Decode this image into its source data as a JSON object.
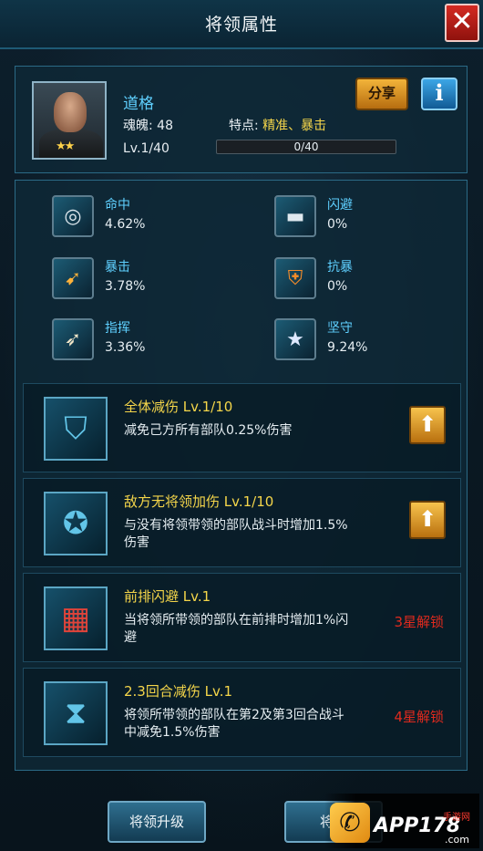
{
  "header": {
    "title": "将领属性",
    "close_symbol": "✕"
  },
  "hero": {
    "name": "道格",
    "soul_label": "魂魄: 48",
    "trait_label": "特点:",
    "trait_value": "精准、暴击",
    "level": "Lv.1/40",
    "exp_text": "0/40",
    "exp_fraction": 0,
    "stars": "★★",
    "share_label": "分享",
    "info_label": "i"
  },
  "stats": [
    {
      "name": "命中",
      "value": "4.62%",
      "icon": "target-icon"
    },
    {
      "name": "闪避",
      "value": "0%",
      "icon": "tank-icon"
    },
    {
      "name": "暴击",
      "value": "3.78%",
      "icon": "missile-icon"
    },
    {
      "name": "抗暴",
      "value": "0%",
      "icon": "shield-badge-icon"
    },
    {
      "name": "指挥",
      "value": "3.36%",
      "icon": "rocket-icon"
    },
    {
      "name": "坚守",
      "value": "9.24%",
      "icon": "star-shield-icon"
    }
  ],
  "skills": [
    {
      "name": "全体减伤 Lv.1/10",
      "desc": "减免己方所有部队0.25%伤害",
      "action": "upgrade",
      "icon": "shield-skill-icon"
    },
    {
      "name": "敌方无将领加伤 Lv.1/10",
      "desc": "与没有将领带领的部队战斗时增加1.5%伤害",
      "action": "upgrade",
      "icon": "medal-skill-icon"
    },
    {
      "name": "前排闪避 Lv.1",
      "desc": "当将领所带领的部队在前排时增加1%闪避",
      "lock": "3星解锁",
      "icon": "grid-skill-icon"
    },
    {
      "name": "2.3回合减伤 Lv.1",
      "desc": "将领所带领的部队在第2及第3回合战斗中减免1.5%伤害",
      "lock": "4星解锁",
      "icon": "hourglass-skill-icon"
    }
  ],
  "bottom": {
    "upgrade_label": "将领升级",
    "second_label": "将领"
  },
  "watermark": {
    "text": "APP178",
    "sub": "手游网",
    "url": ".com"
  },
  "colors": {
    "accent": "#5fd0ff",
    "gold": "#f5d64a",
    "lock_red": "#e02a1e"
  }
}
